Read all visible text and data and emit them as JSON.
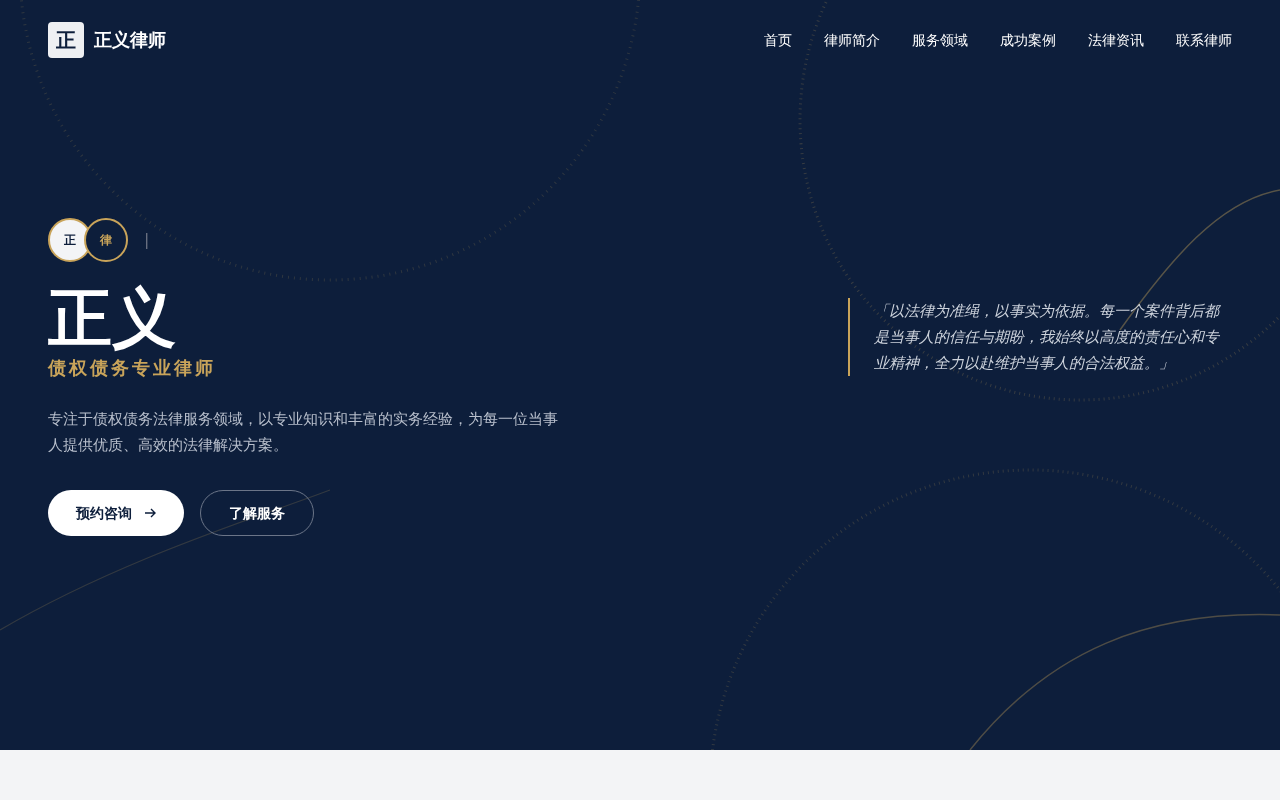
{
  "logo": {
    "mark": "正",
    "name": "正义律师"
  },
  "nav": [
    {
      "label": "首页"
    },
    {
      "label": "律师简介"
    },
    {
      "label": "服务领域"
    },
    {
      "label": "成功案例"
    },
    {
      "label": "法律资讯"
    },
    {
      "label": "联系律师"
    }
  ],
  "hero": {
    "badges": [
      {
        "label": "正",
        "kind": "light"
      },
      {
        "label": "律",
        "kind": "dark"
      }
    ],
    "separator": "|",
    "title": "正义",
    "subtitle": "债权债务专业律师",
    "description": "专注于债权债务法律服务领域，以专业知识和丰富的实务经验，为每一位当事人提供优质、高效的法律解决方案。",
    "buttons": [
      {
        "label": "预约咨询",
        "kind": "primary"
      },
      {
        "label": "了解服务",
        "kind": "outline"
      }
    ],
    "quote": "「以法律为准绳，以事实为依据。每一个案件背后都是当事人的信任与期盼，我始终以高度的责任心和专业精神，全力以赴维护当事人的合法权益。」"
  }
}
